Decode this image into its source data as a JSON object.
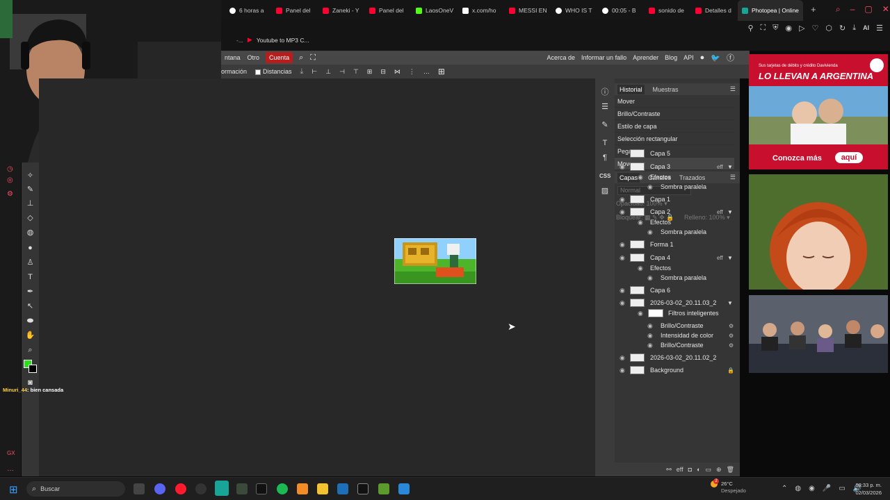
{
  "browser": {
    "tabs": [
      {
        "label": "6 horas a",
        "icon": "google-icon",
        "color": "#ffffff"
      },
      {
        "label": "Panel del",
        "icon": "youtube-icon",
        "color": "#ff0033"
      },
      {
        "label": "Zaneki - Y",
        "icon": "youtube-icon",
        "color": "#ff0033"
      },
      {
        "label": "Panel del",
        "icon": "youtube-icon",
        "color": "#ff0033"
      },
      {
        "label": "LaosOneV",
        "icon": "kick-icon",
        "color": "#53fc18"
      },
      {
        "label": "x.com/ho",
        "icon": "x-icon",
        "color": "#ffffff"
      },
      {
        "label": "MESSI EN",
        "icon": "youtube-icon",
        "color": "#ff0033"
      },
      {
        "label": "WHO IS T",
        "icon": "google-icon",
        "color": "#ffffff"
      },
      {
        "label": "00:05 - B",
        "icon": "google-icon",
        "color": "#ffffff"
      },
      {
        "label": "sonido de",
        "icon": "youtube-icon",
        "color": "#ff0033"
      },
      {
        "label": "Detalles d",
        "icon": "youtube-icon",
        "color": "#ff0033"
      },
      {
        "label": "Photopea | Online",
        "icon": "photopea-icon",
        "color": "#18a497",
        "active": true
      }
    ],
    "new_tab": "+",
    "ai_label": "AI",
    "bookmark": "Youtube to MP3 C...",
    "bookmark_prefix": "-..."
  },
  "photopea": {
    "menu": [
      "ntana",
      "Otro",
      "Cuenta"
    ],
    "menu_right": [
      "Acerca de",
      "Informar un fallo",
      "Aprender",
      "Blog",
      "API"
    ],
    "options_label": "ormación",
    "distances_label": "Distancias"
  },
  "history": {
    "tabs": [
      "Historial",
      "Muestras"
    ],
    "items": [
      "Mover",
      "Brillo/Contraste",
      "Estilo de capa",
      "Selección rectangular",
      "Pegar",
      "Mover"
    ]
  },
  "layers": {
    "tabs": [
      "Capas",
      "Canales",
      "Trazados"
    ],
    "blend_mode": "Normal",
    "opacity_label": "Opacidad:",
    "opacity_value": "100%",
    "lock_label": "Bloquear:",
    "fill_label": "Relleno:",
    "fill_value": "100%",
    "fx_label": "eff",
    "rows": [
      {
        "name": "Capa 5",
        "level": 0,
        "visible": false,
        "fx": false
      },
      {
        "name": "Capa 3",
        "level": 0,
        "visible": true,
        "fx": true
      },
      {
        "name": "Efectos",
        "level": 1
      },
      {
        "name": "Sombra paralela",
        "level": 2
      },
      {
        "name": "Capa 1",
        "level": 0,
        "visible": true,
        "fx": false
      },
      {
        "name": "Capa 2",
        "level": 0,
        "visible": true,
        "fx": true
      },
      {
        "name": "Efectos",
        "level": 1
      },
      {
        "name": "Sombra paralela",
        "level": 2
      },
      {
        "name": "Forma 1",
        "level": 0,
        "visible": true,
        "fx": false
      },
      {
        "name": "Capa 4",
        "level": 0,
        "visible": true,
        "fx": true
      },
      {
        "name": "Efectos",
        "level": 1
      },
      {
        "name": "Sombra paralela",
        "level": 2
      },
      {
        "name": "Capa 6",
        "level": 0,
        "visible": true,
        "fx": false
      },
      {
        "name": "2026-03-02_20.11.03_2",
        "level": 0,
        "visible": true,
        "fx": false,
        "arrow": true
      },
      {
        "name": "Filtros inteligentes",
        "level": 1,
        "mask": true
      },
      {
        "name": "Brillo/Contraste",
        "level": 2,
        "gear": true
      },
      {
        "name": "Intensidad de color",
        "level": 2,
        "gear": true
      },
      {
        "name": "Brillo/Contraste",
        "level": 2,
        "gear": true
      },
      {
        "name": "2026-03-02_20.11.02_2",
        "level": 0,
        "visible": true,
        "fx": false
      },
      {
        "name": "Background",
        "level": 0,
        "visible": true,
        "fx": false,
        "lock": true
      }
    ]
  },
  "ads": {
    "ad1_top": "Sus tarjetas de débito y crédito Davivienda",
    "ad1_headline": "LO LLEVAN A ARGENTINA",
    "ad1_cta": "Conozca más",
    "ad1_cta2": "aquí"
  },
  "chat": {
    "user": "Minuri_44",
    "message": "bien cansada"
  },
  "taskbar": {
    "search_placeholder": "Buscar",
    "weather_temp": "26°C",
    "weather_desc": "Despejado",
    "weather_badge": "2",
    "time": "08:33 p. m.",
    "date": "02/03/2026"
  },
  "colors": {
    "accent": "#b71d1d",
    "fg_swatch": "#28e11a",
    "bg_swatch": "#000000"
  }
}
